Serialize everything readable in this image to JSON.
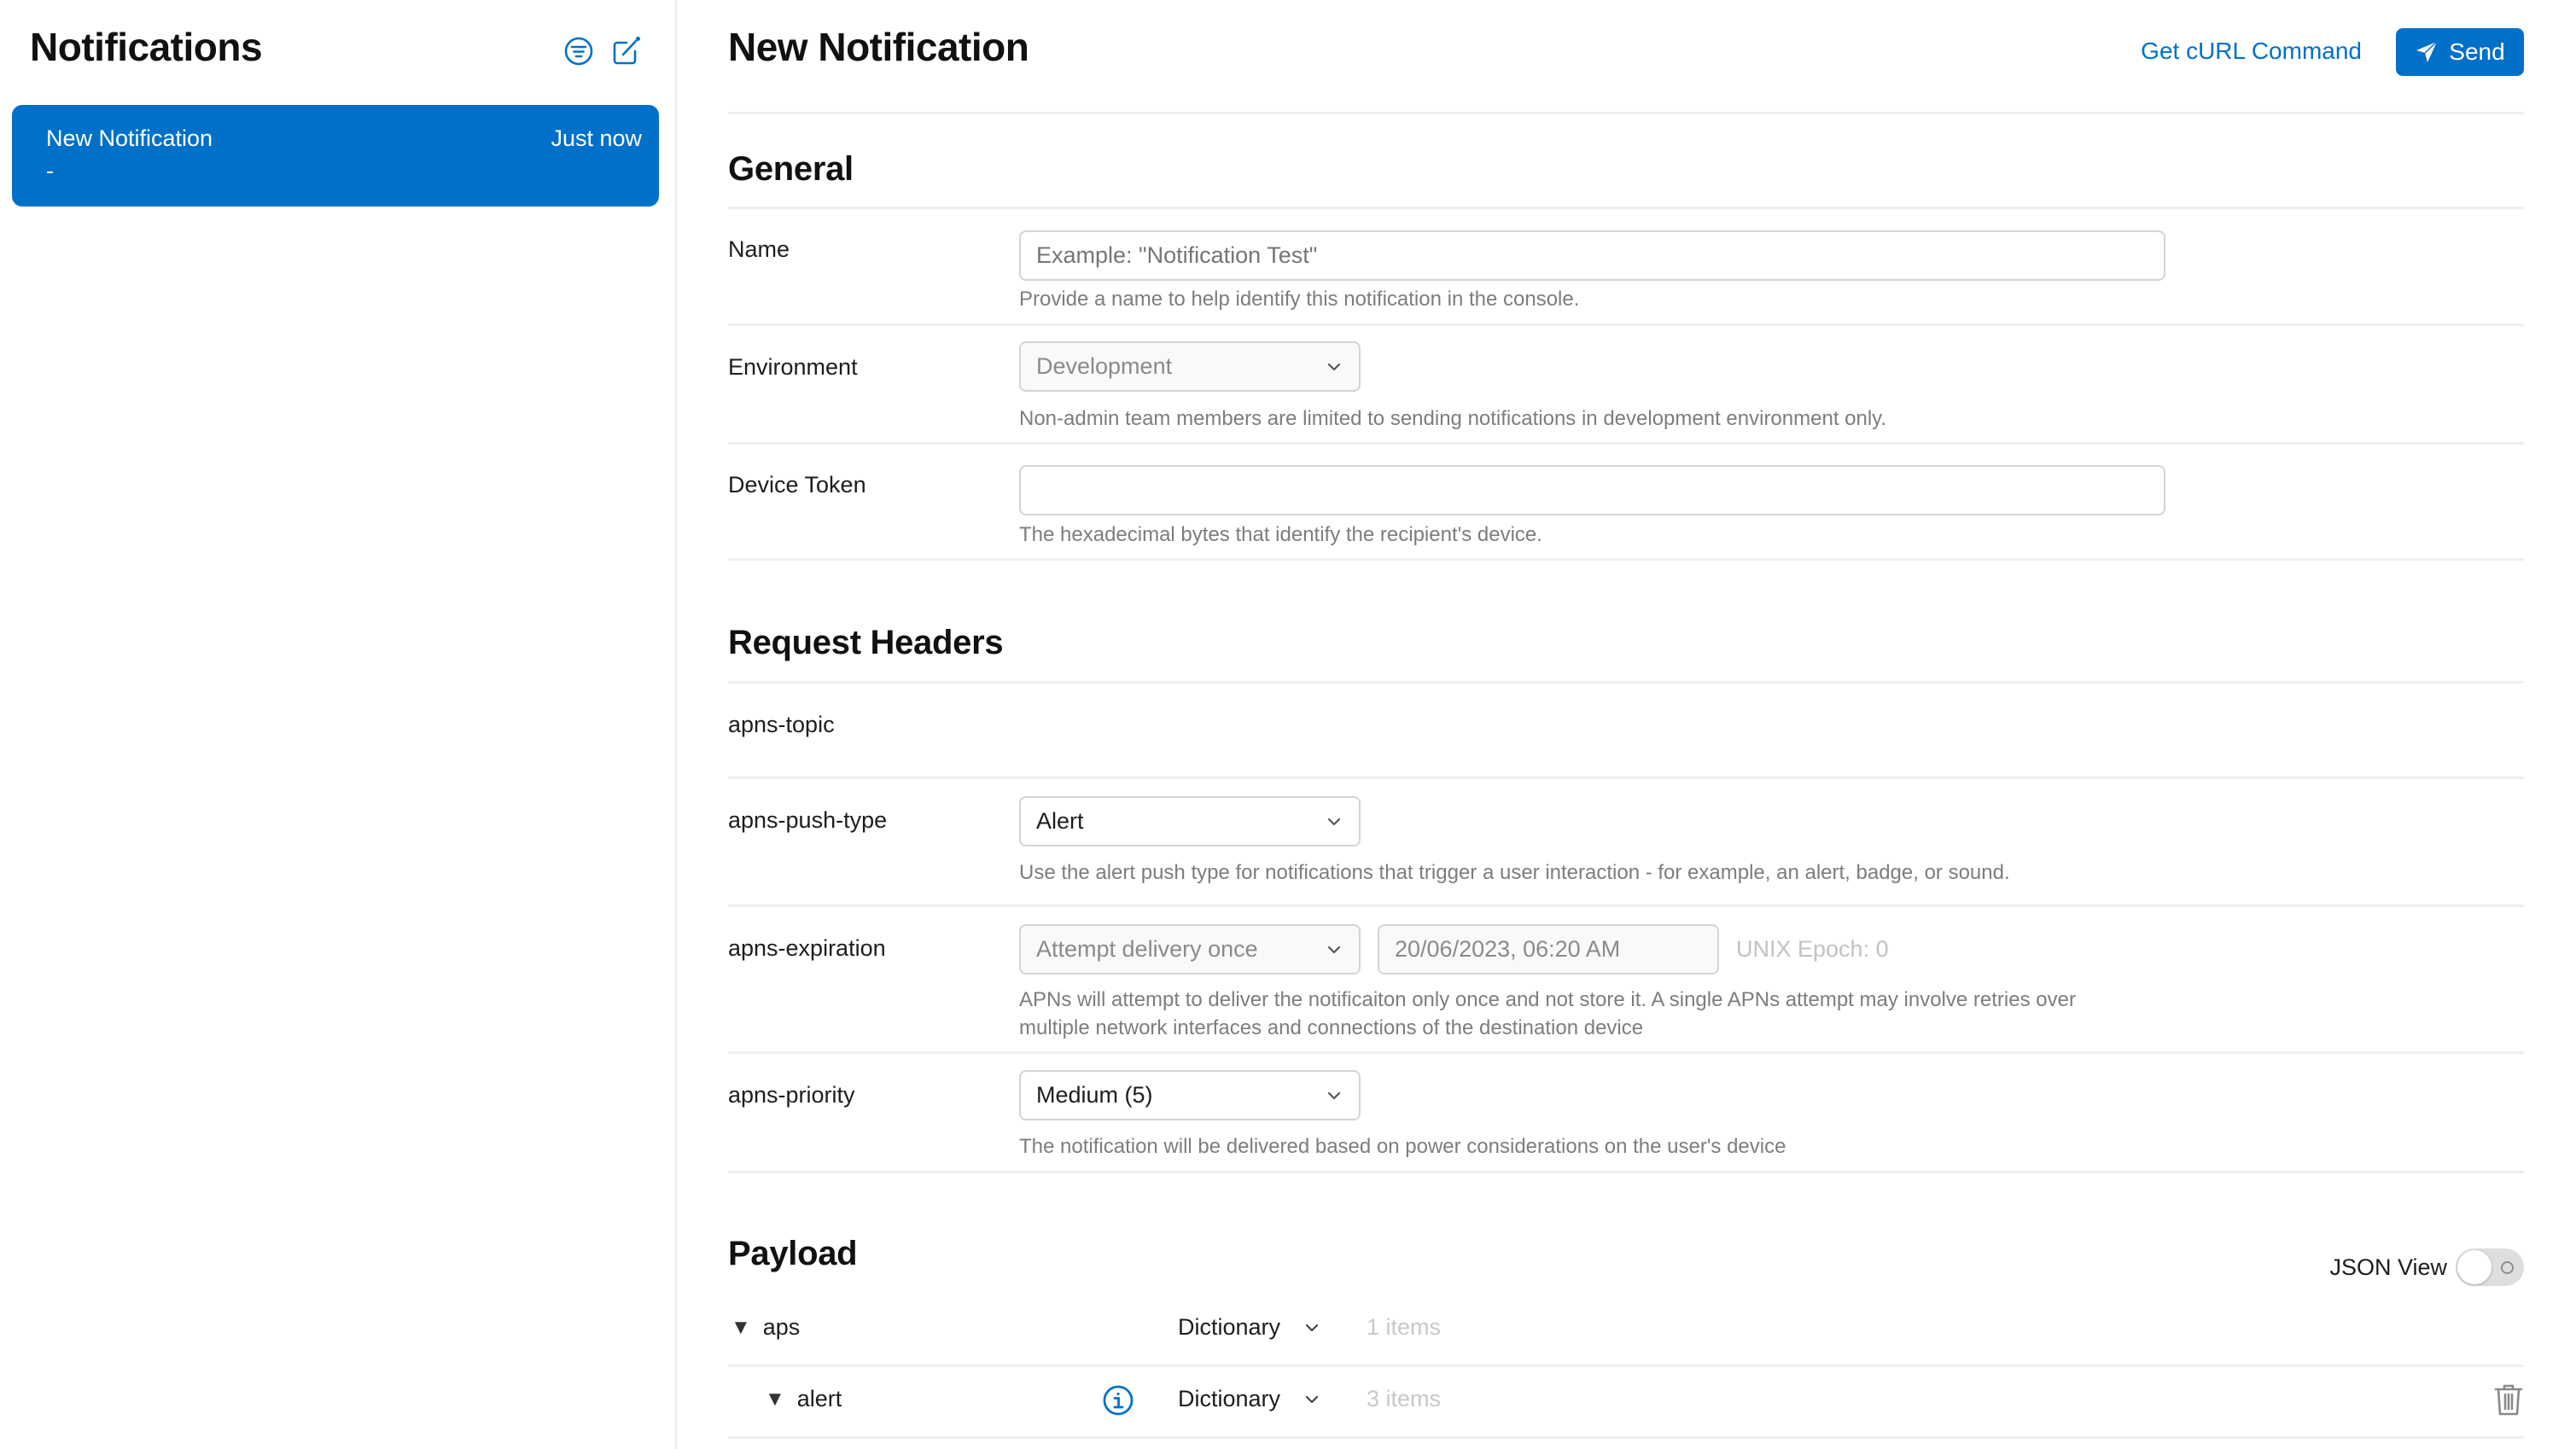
{
  "sidebar": {
    "title": "Notifications",
    "icons": {
      "filter": "filter-circle-icon",
      "compose": "compose-icon"
    },
    "items": [
      {
        "name": "New Notification",
        "time": "Just now",
        "subtitle": "-",
        "selected": true
      }
    ]
  },
  "header": {
    "title": "New Notification",
    "curl_label": "Get cURL Command",
    "send_label": "Send"
  },
  "general": {
    "title": "General",
    "name": {
      "label": "Name",
      "value": "",
      "placeholder": "Example: \"Notification Test\"",
      "help": "Provide a name to help identify this notification in the console."
    },
    "environment": {
      "label": "Environment",
      "value": "Development",
      "help": "Non-admin team members are limited to sending notifications in development environment only."
    },
    "device_token": {
      "label": "Device Token",
      "value": "",
      "help": "The hexadecimal bytes that identify the recipient's device."
    }
  },
  "request_headers": {
    "title": "Request Headers",
    "apns_topic": {
      "label": "apns-topic"
    },
    "apns_push_type": {
      "label": "apns-push-type",
      "value": "Alert",
      "help": "Use the alert push type for notifications that trigger a user interaction - for example, an alert, badge, or sound."
    },
    "apns_expiration": {
      "label": "apns-expiration",
      "value": "Attempt delivery once",
      "date_value": "20/06/2023, 06:20 AM",
      "epoch": "UNIX Epoch: 0",
      "help_line1": "APNs will attempt to deliver the notificaiton only once and not store it. A single APNs attempt may involve retries over",
      "help_line2": "multiple network interfaces and connections of the destination device"
    },
    "apns_priority": {
      "label": "apns-priority",
      "value": "Medium (5)",
      "help": "The notification will be delivered based on power considerations on the user's device"
    }
  },
  "payload": {
    "title": "Payload",
    "json_view_label": "JSON View",
    "json_view_on": false,
    "tree": [
      {
        "key": "aps",
        "type": "Dictionary",
        "count": "1 items",
        "expanded": true,
        "depth": 0
      },
      {
        "key": "alert",
        "type": "Dictionary",
        "count": "3 items",
        "expanded": true,
        "depth": 1
      }
    ]
  },
  "colors": {
    "accent": "#0070c9",
    "text": "#1d1d1f",
    "help_text": "#7d7d7d",
    "divider": "#efefef"
  }
}
